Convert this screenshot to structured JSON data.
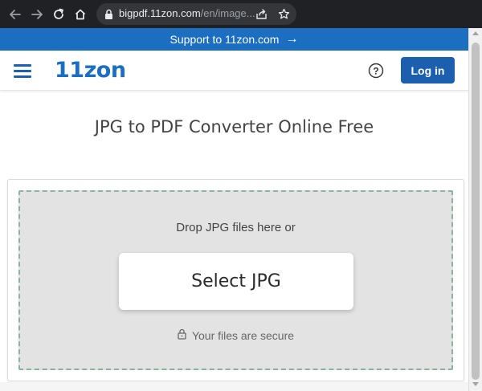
{
  "browser": {
    "url_host": "bigpdf.11zon.com",
    "url_path": "/en/image..."
  },
  "support_bar": {
    "text": "Support to 11zon.com",
    "arrow": "→"
  },
  "header": {
    "logo": "11zon",
    "login_label": "Log in",
    "help_glyph": "?"
  },
  "main": {
    "title": "JPG to PDF Converter Online Free",
    "drop_text": "Drop JPG files here or",
    "select_label": "Select JPG",
    "secure_text": "Your files are secure"
  },
  "colors": {
    "brand_blue": "#1c6fc0",
    "login_blue": "#1c5fae",
    "browser_dark": "#202124",
    "dropzone_bg": "#e3e3e3",
    "dropzone_border": "#8bb3a0"
  }
}
